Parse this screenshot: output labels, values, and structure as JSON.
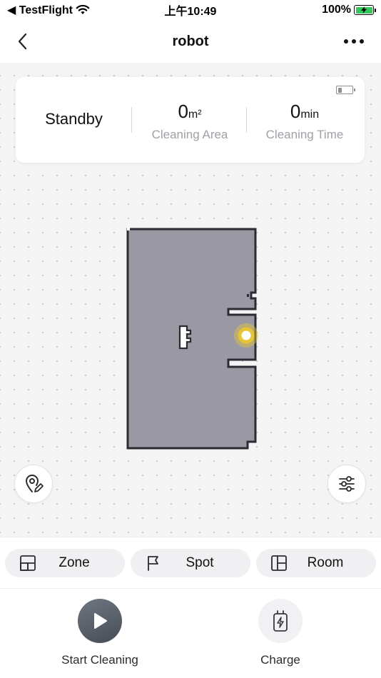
{
  "status_bar": {
    "carrier": "◀ TestFlight",
    "time": "上午10:49",
    "battery": "100%"
  },
  "header": {
    "title": "robot"
  },
  "status_card": {
    "state": "Standby",
    "area_value": "0",
    "area_unit": "m²",
    "area_label": "Cleaning Area",
    "time_value": "0",
    "time_unit": "min",
    "time_label": "Cleaning Time"
  },
  "map": {
    "floor_color": "#9a99a3",
    "wall_color": "#2b2b33",
    "robot_color": "#e6c637"
  },
  "modes": [
    {
      "label": "Zone",
      "icon": "zone-icon"
    },
    {
      "label": "Spot",
      "icon": "flag-icon"
    },
    {
      "label": "Room",
      "icon": "room-icon"
    }
  ],
  "actions": {
    "start_label": "Start Cleaning",
    "charge_label": "Charge"
  }
}
